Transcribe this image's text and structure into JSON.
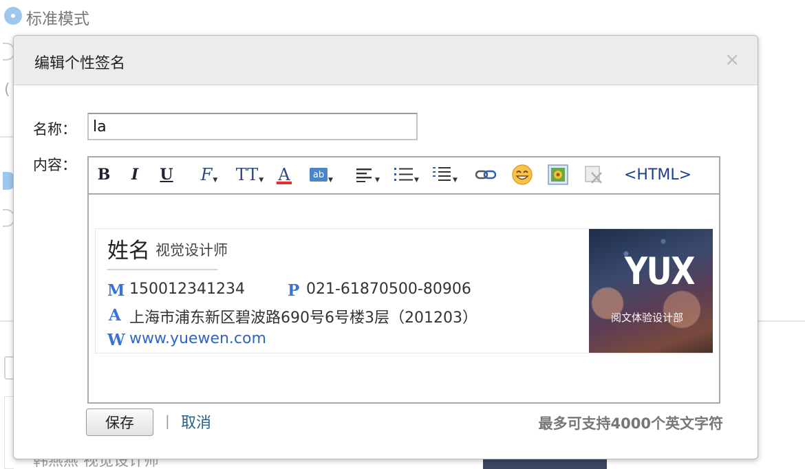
{
  "background": {
    "mode_label": "标准模式",
    "paren": "(",
    "under_text": "韩燕燕 视觉设计师"
  },
  "dialog": {
    "title": "编辑个性签名",
    "close_glyph": "×",
    "name_label": "名称：",
    "name_value": "la",
    "content_label": "内容：",
    "toolbar": {
      "bold": "B",
      "italic": "I",
      "underline": "U",
      "font_family": "F",
      "font_size": "TT",
      "font_color": "A",
      "bg_color": "ab",
      "html": "<HTML>"
    },
    "signature": {
      "name": "姓名",
      "role": "视觉设计师",
      "mobile_key": "M",
      "mobile": "150012341234",
      "phone_key": "P",
      "phone": "021-61870500-80906",
      "address_key": "A",
      "address": "上海市浦东新区碧波路690号6号楼3层（201203）",
      "web_key": "W",
      "web": "www.yuewen.com",
      "image_title": "YUX",
      "image_caption": "阅文体验设计部"
    },
    "save_label": "保存",
    "separator": "|",
    "cancel_label": "取消",
    "limit_note": "最多可支持4000个英文字符"
  }
}
